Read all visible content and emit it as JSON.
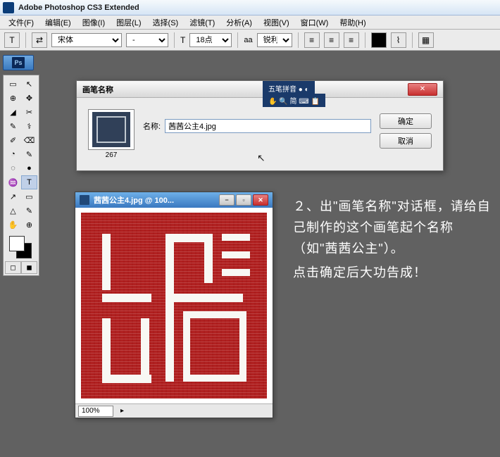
{
  "title_bar": {
    "app_title": "Adobe Photoshop CS3 Extended"
  },
  "menu": {
    "file": "文件(F)",
    "edit": "编辑(E)",
    "image": "图像(I)",
    "layer": "图层(L)",
    "select": "选择(S)",
    "filter": "滤镜(T)",
    "analysis": "分析(A)",
    "view": "视图(V)",
    "window": "窗口(W)",
    "help": "帮助(H)"
  },
  "options": {
    "tool_glyph": "T",
    "font_family": "宋体",
    "font_style": "-",
    "size_label_glyph": "T",
    "font_size": "18点",
    "aa_label": "aa",
    "aa_mode": "锐利"
  },
  "tools": {
    "ps_label": "Ps",
    "row1": [
      "▭",
      "↖"
    ],
    "row2": [
      "⊕",
      "✥"
    ],
    "row3": [
      "◢",
      "✂"
    ],
    "row4": [
      "✎",
      "⚕"
    ],
    "row5": [
      "✐",
      "⌫"
    ],
    "row6": [
      "◔",
      "✎"
    ],
    "row7": [
      "◌",
      "●"
    ],
    "row8": [
      "♒",
      "△"
    ],
    "row9": [
      "✎",
      "T"
    ],
    "row10": [
      "↗",
      "▭"
    ],
    "row11": [
      "✋",
      "⊕"
    ],
    "mode1": "◻",
    "mode2": "◼"
  },
  "dialog": {
    "title": "画笔名称",
    "brush_size": "267",
    "name_label": "名称:",
    "name_value": "茜茜公主4.jpg",
    "ok": "确定",
    "cancel": "取消",
    "ime_line1": "五笔拼音 ● ◐",
    "ime_line2": "✋ 🔍 简 ⌨ 📋"
  },
  "doc_window": {
    "title": "茜茜公主4.jpg @ 100...",
    "zoom": "100%",
    "arrow": "▸"
  },
  "instruction": {
    "p1": "２、出\"画笔名称\"对话框，请给自己制作的这个画笔起个名称（如\"茜茜公主\"）。",
    "p2": "点击确定后大功告成！"
  }
}
